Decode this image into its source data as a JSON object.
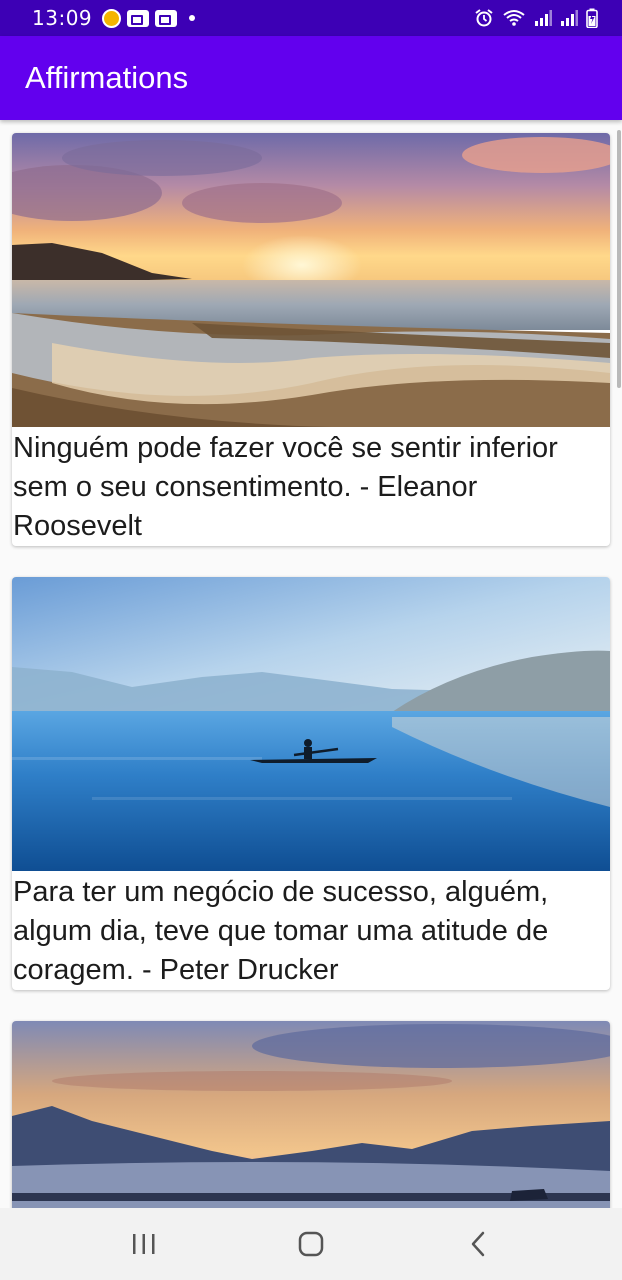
{
  "status_bar": {
    "time": "13:09",
    "icons": [
      "notification-circle-icon",
      "media-notification-icon",
      "media-notification-icon",
      "dot-icon",
      "alarm-icon",
      "wifi-icon",
      "signal-icon",
      "signal-icon",
      "battery-charging-icon"
    ]
  },
  "app_bar": {
    "title": "Affirmations",
    "color": "#6200ee",
    "status_color": "#3d00b5"
  },
  "cards": [
    {
      "text": "Ninguém pode fazer você se sentir inferior sem o seu consentimento. - Eleanor Roosevelt",
      "image": "beach sunset"
    },
    {
      "text": "Para ter um negócio de sucesso, alguém, algum dia, teve que tomar uma atitude de coragem. - Peter Drucker",
      "image": "kayak on lake"
    },
    {
      "text": "",
      "image": "mountain lake at dusk"
    }
  ],
  "nav_bar": {
    "buttons": [
      "recent-apps-icon",
      "home-icon",
      "back-icon"
    ]
  }
}
